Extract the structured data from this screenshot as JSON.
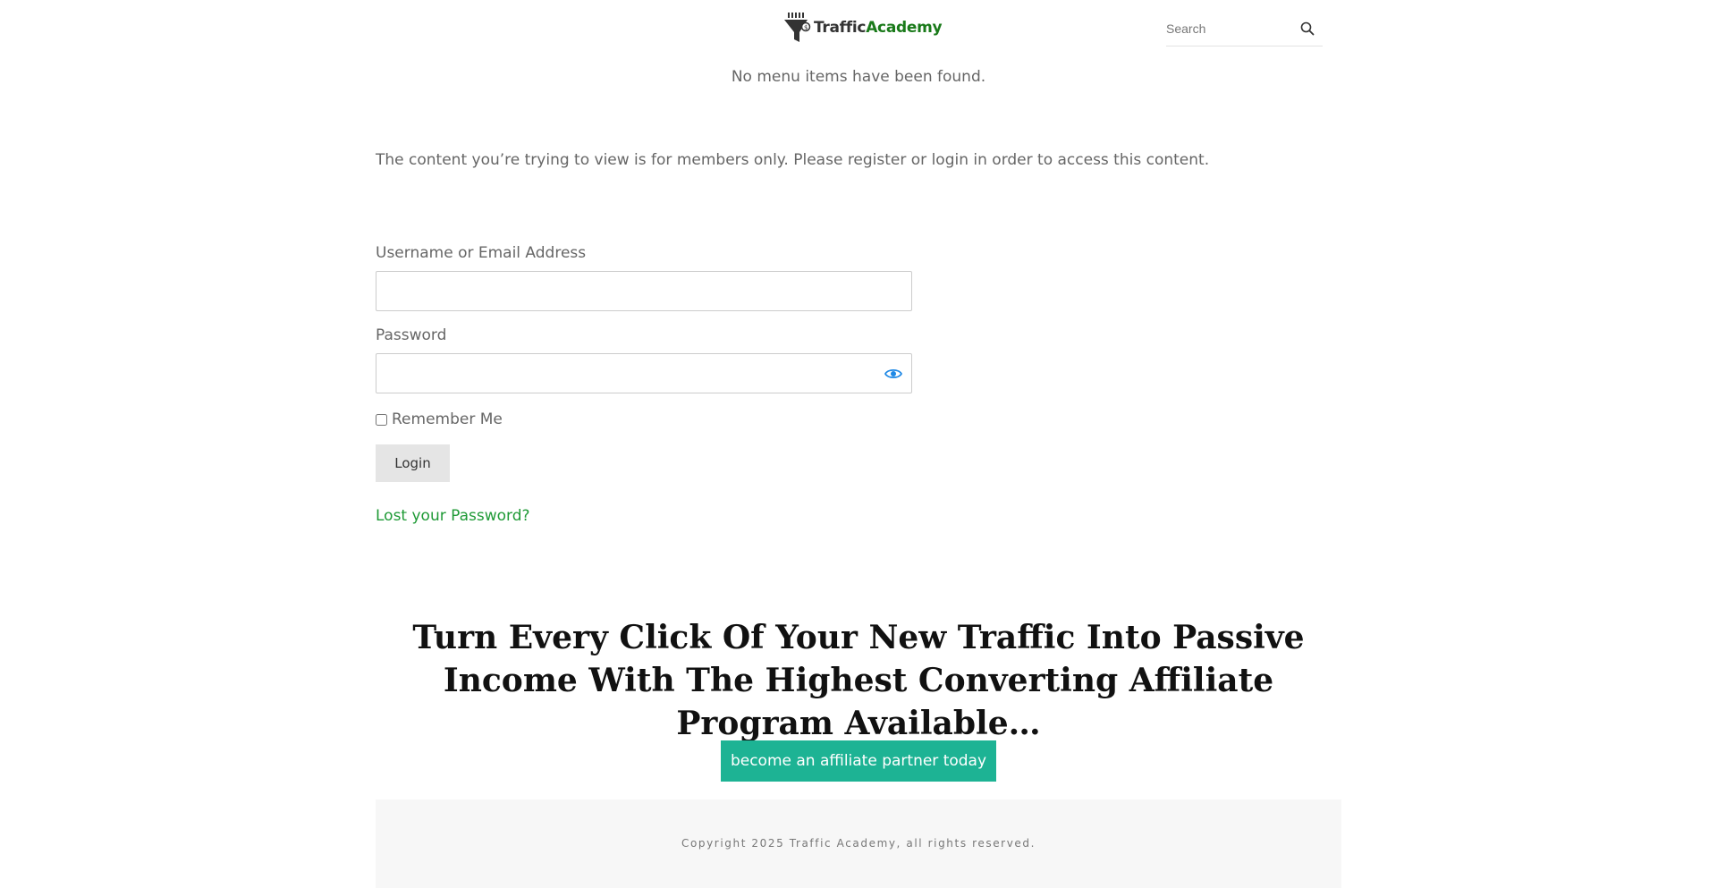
{
  "header": {
    "logo": {
      "text_primary": "Traffic",
      "text_accent": "Academy"
    },
    "search": {
      "placeholder": "Search"
    }
  },
  "menu_note": "No menu items have been found.",
  "members_notice": "The content you’re trying to view is for members only. Please register or login in order to access this content.",
  "login_form": {
    "username_label": "Username or Email Address",
    "password_label": "Password",
    "remember_label": "Remember Me",
    "login_button": "Login",
    "lost_password_link": "Lost your Password?"
  },
  "promo": {
    "headline": "Turn Every Click Of Your New Traffic Into Passive Income With The Highest Converting Affiliate Program Available…",
    "cta_button": "become an affiliate partner today"
  },
  "footer": {
    "copyright": "Copyright 2025 Traffic Academy, all rights reserved."
  },
  "colors": {
    "accent_green": "#1f9a36",
    "cta_teal": "#1db394",
    "eye_icon_blue": "#1e88e5"
  }
}
